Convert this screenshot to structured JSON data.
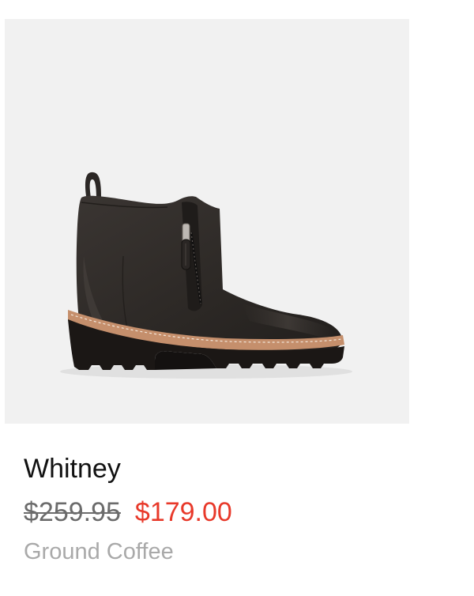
{
  "product": {
    "name": "Whitney",
    "original_price": "$259.95",
    "sale_price": "$179.00",
    "color": "Ground Coffee",
    "image_icon": "ankle-boot-photo"
  },
  "colors": {
    "image_background": "#f1f1f1",
    "sale_price": "#e8392a",
    "original_price": "#6b6b6b",
    "color_text": "#a9a9a9",
    "boot_leather": "#2e2a27",
    "boot_sole": "#1a1614",
    "welt": "#c58f6c"
  }
}
